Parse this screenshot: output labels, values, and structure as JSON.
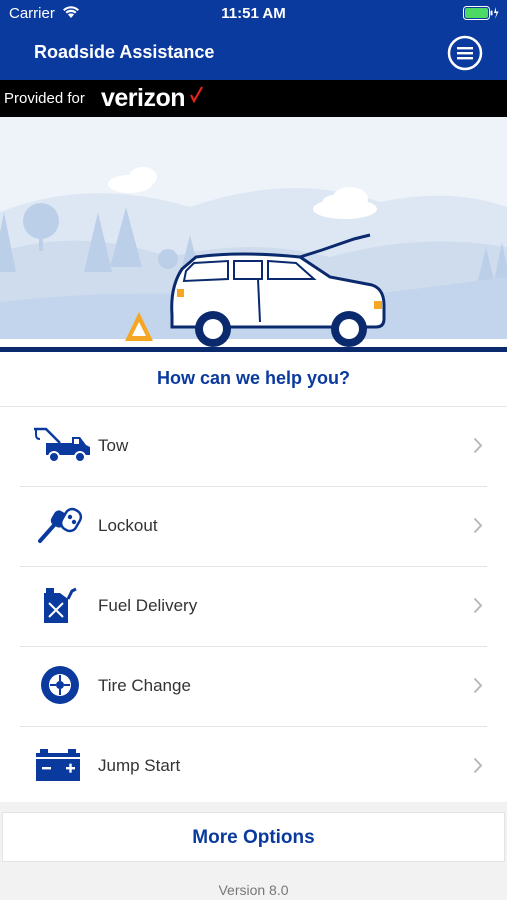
{
  "status_bar": {
    "carrier": "Carrier",
    "time": "11:51 AM"
  },
  "header": {
    "title": "Roadside Assistance",
    "menu_icon": "hamburger-menu-icon"
  },
  "provider": {
    "label": "Provided for",
    "brand": "verizon"
  },
  "main": {
    "question": "How can we help you?",
    "services": [
      {
        "label": "Tow",
        "icon": "tow-truck-icon"
      },
      {
        "label": "Lockout",
        "icon": "car-key-icon"
      },
      {
        "label": "Fuel Delivery",
        "icon": "fuel-can-icon"
      },
      {
        "label": "Tire Change",
        "icon": "tire-icon"
      },
      {
        "label": "Jump Start",
        "icon": "battery-icon"
      }
    ]
  },
  "footer": {
    "more_options": "More Options",
    "version": "Version 8.0"
  },
  "colors": {
    "primary": "#0b3a9e",
    "provider_bar": "#000000",
    "brand_check": "#e2231a",
    "warning_triangle": "#f5a623",
    "battery_green": "#4cd964"
  }
}
